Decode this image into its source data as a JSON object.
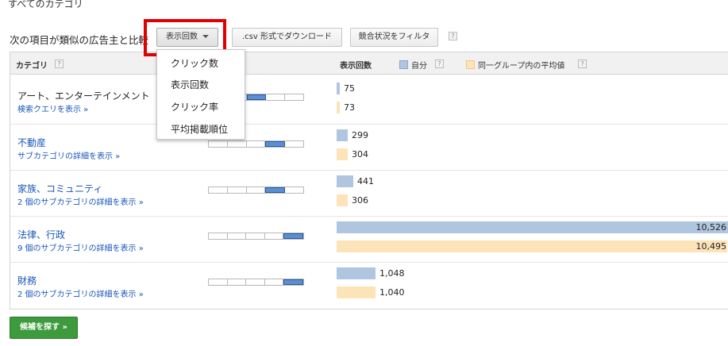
{
  "header": {
    "title": "すべてのカテゴリ",
    "compare_label": "次の項目が類似の広告主と比較",
    "metric_button": "表示回数",
    "csv_button": ".csv 形式でダウンロード",
    "filter_button": "競合状況をフィルタ",
    "help": "?"
  },
  "dropdown": {
    "items": [
      "クリック数",
      "表示回数",
      "クリック率",
      "平均掲載順位"
    ]
  },
  "table": {
    "col_category": "カテゴリ",
    "col_metric": "表示回数",
    "legend_self": "自分",
    "legend_avg": "同一グループ内の平均値",
    "max_value": 10526,
    "rows": [
      {
        "name": "アート、エンターテインメント",
        "name_is_link": false,
        "sub": "検索クエリを表示 »",
        "scale_level": 3,
        "self_value": 75,
        "self_label": "75",
        "avg_value": 73,
        "avg_label": "73"
      },
      {
        "name": "不動産",
        "name_is_link": true,
        "sub": "サブカテゴリの詳細を表示 »",
        "scale_level": 4,
        "self_value": 299,
        "self_label": "299",
        "avg_value": 304,
        "avg_label": "304"
      },
      {
        "name": "家族、コミュニティ",
        "name_is_link": true,
        "sub": "2 個のサブカテゴリの詳細を表示 »",
        "scale_level": 4,
        "self_value": 441,
        "self_label": "441",
        "avg_value": 306,
        "avg_label": "306"
      },
      {
        "name": "法律、行政",
        "name_is_link": true,
        "sub": "9 個のサブカテゴリの詳細を表示 »",
        "scale_level": 5,
        "self_value": 10526,
        "self_label": "10,526",
        "avg_value": 10495,
        "avg_label": "10,495"
      },
      {
        "name": "財務",
        "name_is_link": true,
        "sub": "2 個のサブカテゴリの詳細を表示 »",
        "scale_level": 5,
        "self_value": 1048,
        "self_label": "1,048",
        "avg_value": 1040,
        "avg_label": "1,040"
      }
    ]
  },
  "footer": {
    "find_button": "候補を探す »"
  },
  "colors": {
    "self_bar": "#b0c6e0",
    "avg_bar": "#fde3b8",
    "link": "#1a56b8",
    "highlight": "#e00000",
    "primary_button": "#3d9a3d"
  }
}
